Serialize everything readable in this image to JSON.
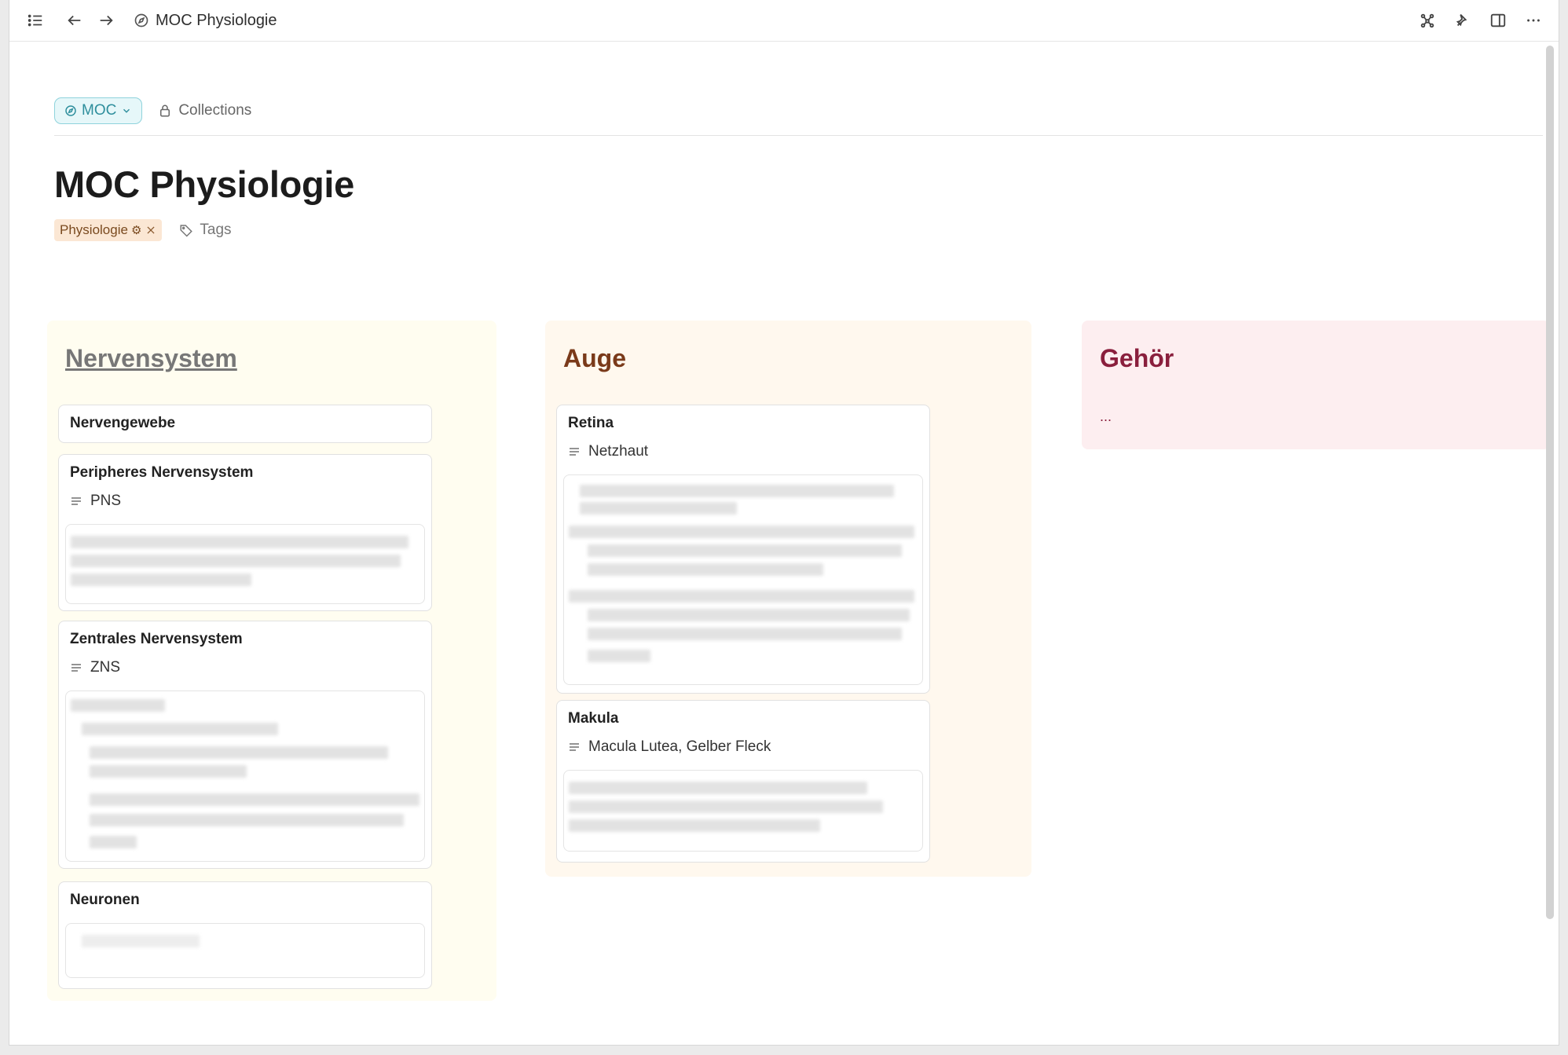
{
  "topbar": {
    "title": "MOC Physiologie",
    "icons": [
      "list-icon",
      "back-arrow-icon",
      "forward-arrow-icon",
      "compass-icon",
      "graph-icon",
      "pin-icon",
      "sidebar-icon",
      "more-icon"
    ]
  },
  "header": {
    "type_chip": "MOC",
    "collections_label": "Collections",
    "title": "MOC Physiologie",
    "tag_label": "Physiologie",
    "tag_glyph": "⚙",
    "tags_button": "Tags"
  },
  "columns": [
    {
      "title": "Nervensystem",
      "color": "#fffdf0",
      "title_color": "#777777",
      "cards": [
        {
          "title": "Nervengewebe"
        },
        {
          "title": "Peripheres Nervensystem",
          "alias": "PNS"
        },
        {
          "title": "Zentrales Nervensystem",
          "alias": "ZNS"
        },
        {
          "title": "Neuronen"
        }
      ]
    },
    {
      "title": "Auge",
      "color": "#fff8ee",
      "title_color": "#7a3a1a",
      "cards": [
        {
          "title": "Retina",
          "alias": "Netzhaut"
        },
        {
          "title": "Makula",
          "alias": "Macula Lutea, Gelber Fleck"
        }
      ]
    },
    {
      "title": "Gehör",
      "color": "#fdeef0",
      "title_color": "#8a1f3d",
      "placeholder": "..."
    }
  ],
  "colors": {
    "accent": "#2f8f9d",
    "tag_bg": "#fbe7d4"
  }
}
